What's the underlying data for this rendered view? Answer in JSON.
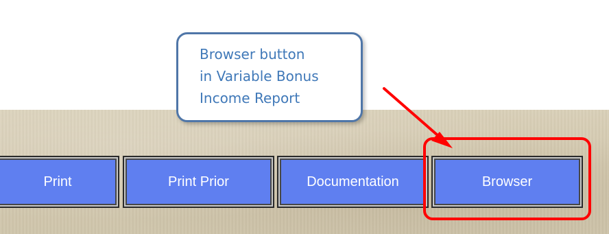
{
  "callout": {
    "lines": [
      "Browser button",
      "in Variable Bonus",
      "Income Report"
    ]
  },
  "toolbar": {
    "buttons": [
      {
        "label": "Print"
      },
      {
        "label": "Print Prior"
      },
      {
        "label": "Documentation"
      },
      {
        "label": "Browser"
      }
    ]
  },
  "colors": {
    "button_fill": "#5f7ff0",
    "button_text": "#ffffff",
    "highlight": "#ff0000",
    "callout_border": "#4f76a8",
    "callout_text": "#3f78b8",
    "background_texture": "#d2c7ad"
  },
  "icons": {
    "annotation_arrow": "arrow-icon"
  }
}
